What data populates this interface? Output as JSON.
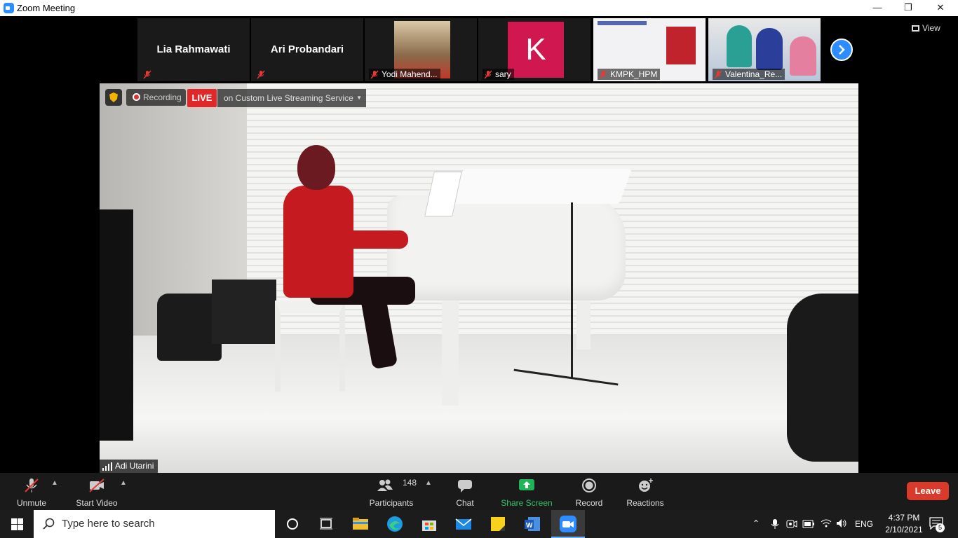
{
  "window": {
    "title": "Zoom Meeting",
    "min": "—",
    "max": "❐",
    "close": "✕"
  },
  "gallery": {
    "tiles": [
      {
        "name": "Lia Rahmawati",
        "label": ""
      },
      {
        "name": "Ari Probandari",
        "label": ""
      },
      {
        "name": "",
        "label": "Yodi Mahend..."
      },
      {
        "name": "K",
        "label": "sary"
      },
      {
        "name": "",
        "label": "KMPK_HPM"
      },
      {
        "name": "",
        "label": "Valentina_Re..."
      }
    ],
    "view_label": "View"
  },
  "stage": {
    "recording_label": "Recording",
    "live_label": "LIVE",
    "stream_label": "on Custom Live Streaming Service",
    "speaker_name": "Adi Utarini"
  },
  "toolbar": {
    "unmute": "Unmute",
    "start_video": "Start Video",
    "participants": "Participants",
    "participants_count": "148",
    "chat": "Chat",
    "share_screen": "Share Screen",
    "record": "Record",
    "reactions": "Reactions",
    "leave": "Leave"
  },
  "taskbar": {
    "search_placeholder": "Type here to search",
    "lang": "ENG",
    "time": "4:37 PM",
    "date": "2/10/2021",
    "notifications": "5"
  },
  "colors": {
    "accent": "#2d8cff",
    "live": "#e02828",
    "leave": "#d83a2b",
    "share": "#20b35a"
  }
}
